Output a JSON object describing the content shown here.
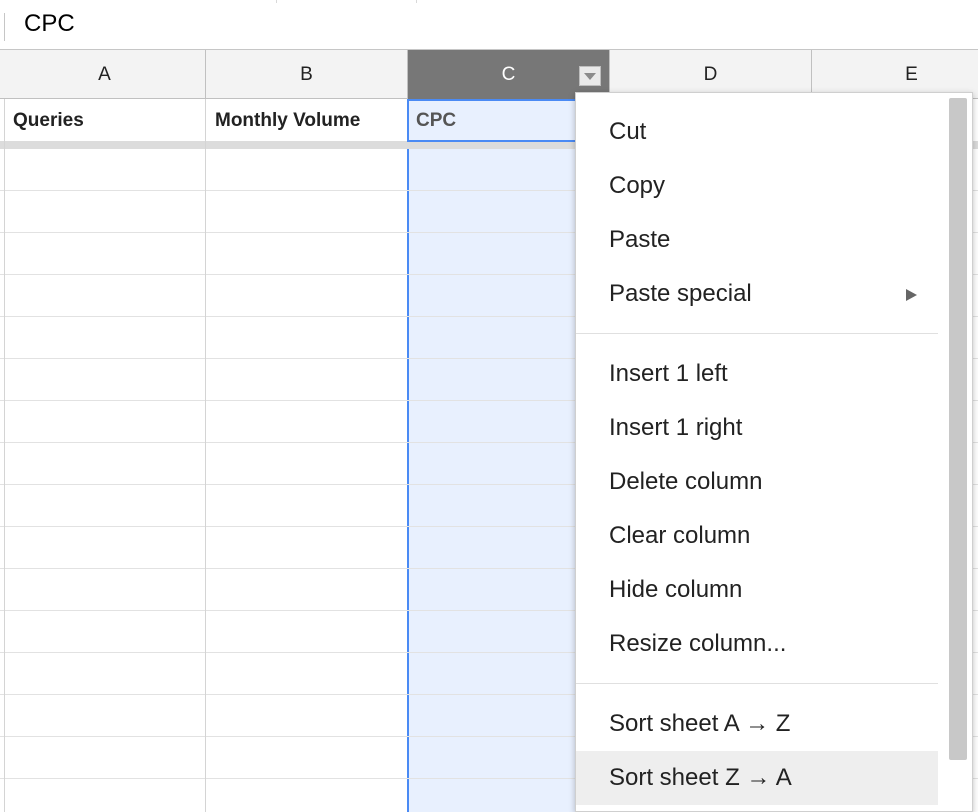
{
  "formula_bar": {
    "value": "CPC"
  },
  "columns": [
    {
      "letter": "A"
    },
    {
      "letter": "B"
    },
    {
      "letter": "C"
    },
    {
      "letter": "D"
    },
    {
      "letter": "E"
    }
  ],
  "header_row": {
    "a": "Queries",
    "b": "Monthly Volume",
    "c": "CPC"
  },
  "menu": {
    "cut": "Cut",
    "copy": "Copy",
    "paste": "Paste",
    "paste_special": "Paste special",
    "insert_left": "Insert 1 left",
    "insert_right": "Insert 1 right",
    "delete_column": "Delete column",
    "clear_column": "Clear column",
    "hide_column": "Hide column",
    "resize_column": "Resize column...",
    "sort_az": "Sort sheet A → Z",
    "sort_za": "Sort sheet Z → A"
  },
  "colors": {
    "selection": "#4a8af4",
    "selected_header": "#777777",
    "selected_fill": "#e8f0fe"
  }
}
